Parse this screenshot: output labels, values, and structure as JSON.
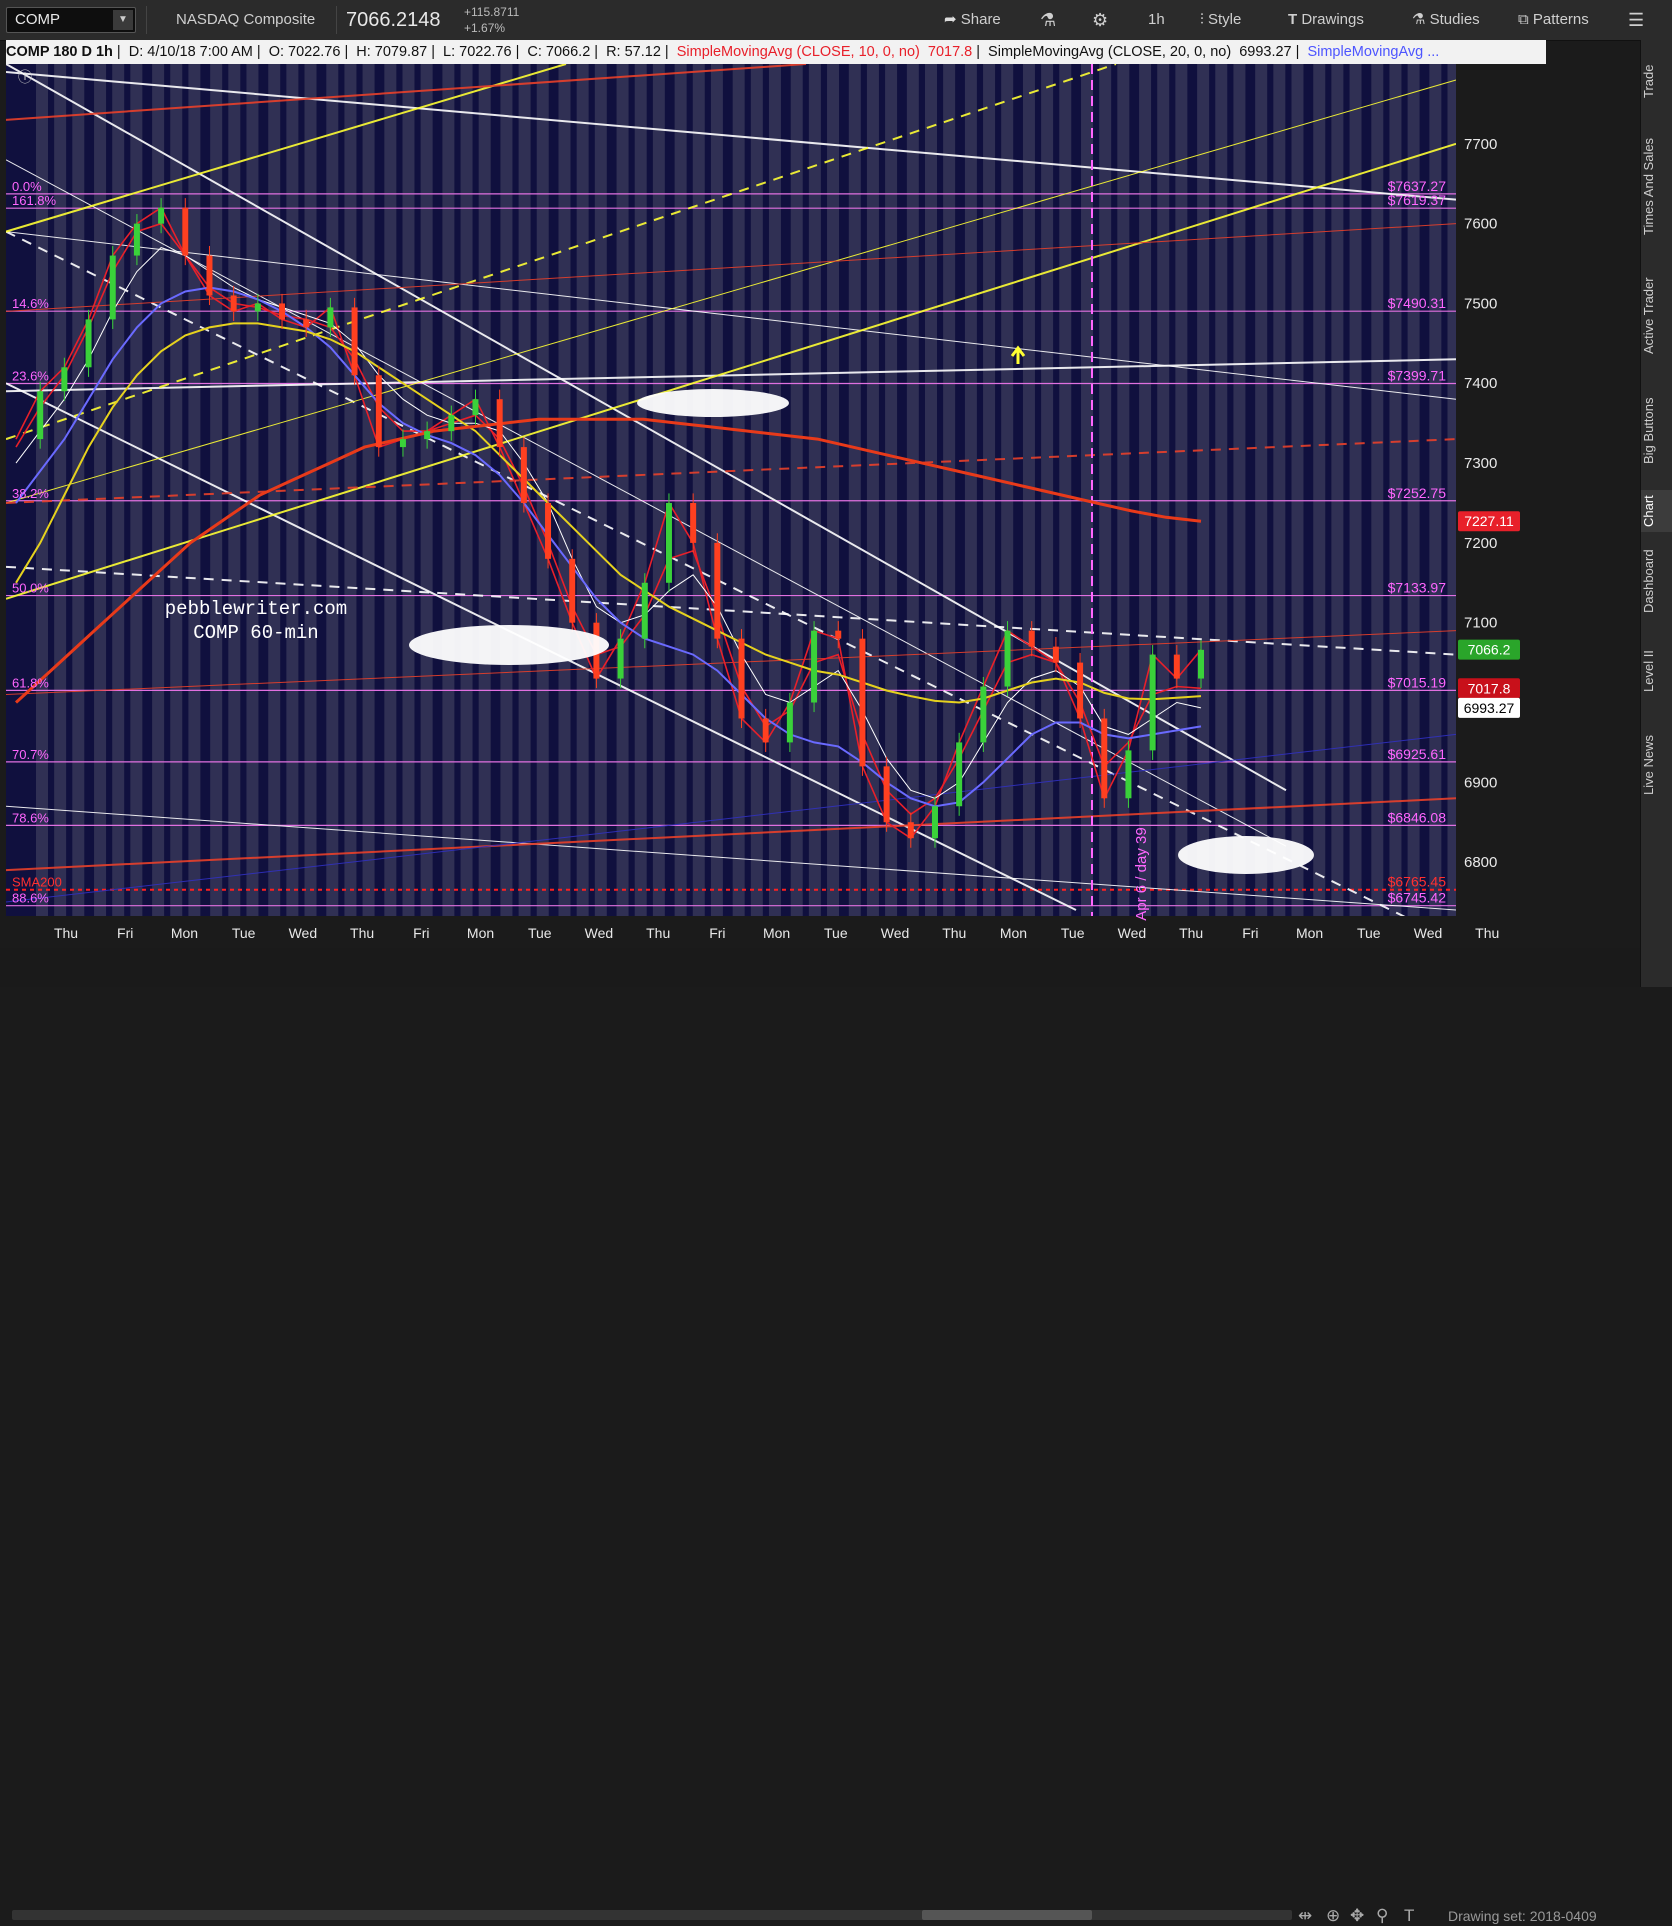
{
  "toolbar": {
    "symbol": "COMP",
    "name": "NASDAQ Composite",
    "last": "7066.2148",
    "change_abs": "+115.8711",
    "change_pct": "+1.67%",
    "share": "Share",
    "interval": "1h",
    "style": "Style",
    "drawings": "Drawings",
    "studies": "Studies",
    "patterns": "Patterns"
  },
  "legend": {
    "title": "COMP 180 D 1h",
    "date": "D: 4/10/18 7:00 AM",
    "open": "O: 7022.76",
    "high": "H: 7079.87",
    "low": "L: 7022.76",
    "close": "C: 7066.2",
    "range": "R: 57.12",
    "sma10": "SimpleMovingAvg (CLOSE, 10, 0, no)",
    "sma10_val": "7017.8",
    "sma20": "SimpleMovingAvg (CLOSE, 20, 0, no)",
    "sma20_val": "6993.27",
    "sma_more": "SimpleMovingAvg ..."
  },
  "right_tabs": [
    "Trade",
    "Times And Sales",
    "Active Trader",
    "Big Buttons",
    "Chart",
    "Dashboard",
    "Level II",
    "Live News"
  ],
  "bottom": {
    "drawing_set": "Drawing set: 2018-0409"
  },
  "chart_data": {
    "type": "line",
    "watermark_site": "pebblewriter.com",
    "watermark_label": "COMP 60-min",
    "time_axis": [
      "Thu",
      "Fri",
      "Mon",
      "Tue",
      "Wed",
      "Thu",
      "Fri",
      "Mon",
      "Tue",
      "Wed",
      "Thu",
      "Fri",
      "Mon",
      "Tue",
      "Wed",
      "Thu",
      "Mon",
      "Tue",
      "Wed",
      "Thu",
      "Fri",
      "Mon",
      "Tue",
      "Wed",
      "Thu"
    ],
    "y_ticks": [
      7700,
      7600,
      7500,
      7400,
      7300,
      7200,
      7100,
      7000,
      6900,
      6800
    ],
    "ylim": [
      6735,
      7800
    ],
    "vertical_marker": "Apr 6 / day 39",
    "fib_levels": [
      {
        "label": "0.0%",
        "price": "$7637.27"
      },
      {
        "label": "161.8%",
        "price": "$7619.37"
      },
      {
        "label": "14.6%",
        "price": "$7490.31"
      },
      {
        "label": "23.6%",
        "price": "$7399.71"
      },
      {
        "label": "38.2%",
        "price": "$7252.75"
      },
      {
        "label": "50.0%",
        "price": "$7133.97"
      },
      {
        "label": "61.8%",
        "price": "$7015.19"
      },
      {
        "label": "70.7%",
        "price": "$6925.61"
      },
      {
        "label": "78.6%",
        "price": "$6846.08"
      },
      {
        "label": "SMA200",
        "price": "$6765.45"
      },
      {
        "label": "88.6%",
        "price": "$6745.42"
      }
    ],
    "price_badges": [
      {
        "label": "7227.11",
        "value": 7227.11,
        "color": "#e8202a"
      },
      {
        "label": "7066.2",
        "value": 7066.2,
        "color": "#2aa52a"
      },
      {
        "label": "7017.8",
        "value": 7017.8,
        "color": "#c8101a"
      },
      {
        "label": "6993.27",
        "value": 6993.27,
        "color": "#ffffff"
      }
    ],
    "series": [
      {
        "name": "COMP",
        "color": "#e8202a",
        "values": [
          7330,
          7390,
          7420,
          7480,
          7560,
          7600,
          7620,
          7560,
          7510,
          7490,
          7500,
          7480,
          7470,
          7495,
          7410,
          7320,
          7330,
          7340,
          7360,
          7380,
          7320,
          7250,
          7180,
          7100,
          7030,
          7080,
          7150,
          7250,
          7200,
          7080,
          6980,
          6950,
          7000,
          7090,
          7080,
          6920,
          6850,
          6830,
          6870,
          6950,
          7020,
          7090,
          7070,
          7050,
          6980,
          6880,
          6940,
          7060,
          7030,
          7066
        ]
      },
      {
        "name": "SMA 10",
        "color": "#e8202a",
        "values": [
          7320,
          7370,
          7410,
          7470,
          7540,
          7590,
          7600,
          7560,
          7520,
          7500,
          7495,
          7485,
          7480,
          7470,
          7430,
          7370,
          7340,
          7340,
          7350,
          7360,
          7330,
          7270,
          7200,
          7120,
          7060,
          7070,
          7110,
          7180,
          7190,
          7110,
          7020,
          6970,
          6990,
          7050,
          7060,
          6960,
          6890,
          6860,
          6880,
          6930,
          6990,
          7050,
          7060,
          7050,
          7000,
          6920,
          6950,
          7010,
          7020,
          7017.8
        ]
      },
      {
        "name": "SMA 20",
        "color": "#ffffff",
        "values": [
          7300,
          7340,
          7380,
          7430,
          7490,
          7540,
          7570,
          7560,
          7540,
          7520,
          7505,
          7495,
          7485,
          7475,
          7450,
          7410,
          7380,
          7360,
          7350,
          7350,
          7340,
          7300,
          7250,
          7180,
          7120,
          7100,
          7110,
          7140,
          7160,
          7120,
          7060,
          7010,
          7000,
          7020,
          7040,
          6990,
          6930,
          6890,
          6880,
          6900,
          6950,
          7000,
          7030,
          7040,
          7020,
          6970,
          6960,
          6980,
          7000,
          6993.27
        ]
      },
      {
        "name": "SMA 50",
        "color": "#6a6aff",
        "values": [
          7250,
          7290,
          7330,
          7380,
          7430,
          7470,
          7500,
          7515,
          7520,
          7515,
          7505,
          7490,
          7470,
          7445,
          7410,
          7375,
          7350,
          7335,
          7325,
          7310,
          7285,
          7250,
          7210,
          7170,
          7130,
          7100,
          7080,
          7070,
          7060,
          7040,
          7010,
          6980,
          6960,
          6950,
          6945,
          6925,
          6900,
          6880,
          6870,
          6875,
          6900,
          6930,
          6960,
          6975,
          6975,
          6960,
          6955,
          6960,
          6965,
          6970
        ]
      },
      {
        "name": "SMA 100",
        "color": "#e6d21e",
        "values": [
          7150,
          7200,
          7260,
          7320,
          7370,
          7410,
          7440,
          7460,
          7470,
          7475,
          7475,
          7470,
          7465,
          7455,
          7440,
          7420,
          7400,
          7380,
          7360,
          7340,
          7310,
          7280,
          7250,
          7220,
          7190,
          7160,
          7140,
          7120,
          7105,
          7090,
          7075,
          7060,
          7050,
          7040,
          7035,
          7025,
          7015,
          7008,
          7002,
          7000,
          7005,
          7015,
          7025,
          7030,
          7025,
          7012,
          7005,
          7004,
          7006,
          7008
        ]
      },
      {
        "name": "SMA 200",
        "color": "#e83a1a",
        "values": [
          7000,
          7040,
          7080,
          7120,
          7160,
          7200,
          7230,
          7260,
          7280,
          7300,
          7320,
          7330,
          7340,
          7345,
          7350,
          7355,
          7355,
          7355,
          7355,
          7350,
          7345,
          7340,
          7335,
          7330,
          7320,
          7310,
          7300,
          7290,
          7280,
          7270,
          7260,
          7250,
          7240,
          7232,
          7227
        ]
      }
    ]
  }
}
